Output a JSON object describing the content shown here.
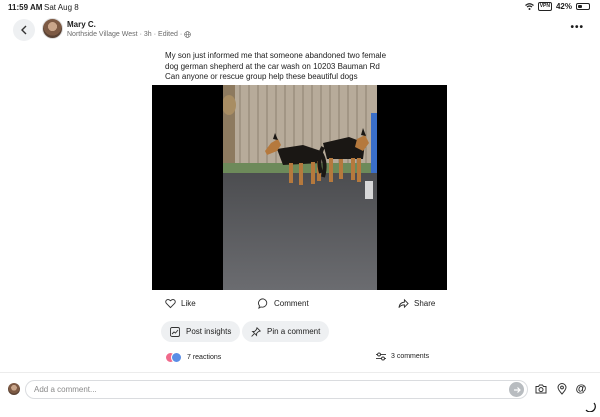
{
  "status_bar": {
    "time": "11:59 AM",
    "date": "Sat Aug 8",
    "vpn": "VPN",
    "battery": "42%",
    "battery_level": 0.42
  },
  "post": {
    "author": "Mary C.",
    "group": "Northside Village West",
    "age": "3h",
    "edited": "Edited",
    "text_lines": [
      "My son just informed me that someone abandoned two female",
      "dog german shepherd  at the car wash on 10203 Bauman Rd",
      "Can anyone or rescue group help these beautiful dogs"
    ]
  },
  "actions": {
    "like": "Like",
    "comment": "Comment",
    "share": "Share"
  },
  "chips": {
    "insights": "Post insights",
    "pin": "Pin a comment"
  },
  "engagement": {
    "reactions": "7 reactions",
    "comments": "3 comments"
  },
  "composer": {
    "placeholder": "Add a comment..."
  },
  "icons": {
    "back": "chevron-left-icon",
    "more": "more-icon",
    "globe": "globe-icon",
    "like": "heart-icon",
    "comment": "speech-bubble-icon",
    "share": "share-icon",
    "insights": "chart-icon",
    "pin": "pin-icon",
    "comments": "sliders-icon",
    "send": "arrow-right-icon",
    "camera": "camera-icon",
    "location": "location-pin-icon",
    "mention": "at-icon"
  },
  "colors": {
    "chip_bg": "#eef0f2",
    "text": "#1c1c1c",
    "muted": "#6b6b6b",
    "reaction_heart": "#f06a8b",
    "reaction_like": "#5a8de6"
  }
}
